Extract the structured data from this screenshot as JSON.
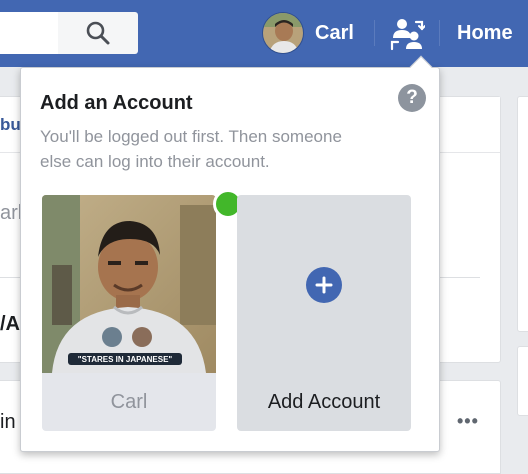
{
  "header": {
    "profile_name": "Carl",
    "home_label": "Home",
    "brand_color": "#4267b2",
    "icons": [
      "search-icon",
      "switch-accounts-icon"
    ]
  },
  "background": {
    "fragment_1": "bu",
    "fragment_2": "arl'",
    "fragment_3": "/A",
    "fragment_4": "in",
    "more_label": "•••"
  },
  "popover": {
    "title": "Add an Account",
    "help_label": "?",
    "description": "You'll be logged out first. Then someone else can log into their account.",
    "accounts": [
      {
        "label": "Carl",
        "online": true,
        "photo_caption": "\"STARES IN JAPANESE\""
      },
      {
        "label": "Add Account",
        "icon": "plus-icon"
      }
    ],
    "online_color": "#42b72a"
  }
}
